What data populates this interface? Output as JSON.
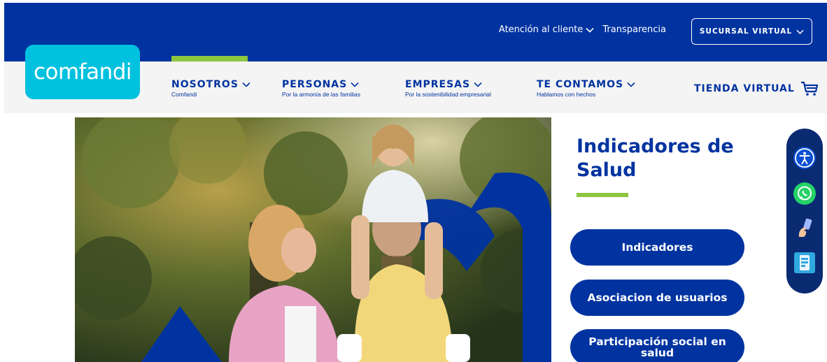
{
  "brand": {
    "logo_text": "comfandi",
    "primary": "#0033a0",
    "accent": "#8dc63f",
    "logo_bg": "#00c1de"
  },
  "topbar": {
    "links": [
      {
        "label": "Atención al cliente",
        "icon": "chevron-down-icon"
      },
      {
        "label": "Transparencia"
      }
    ],
    "sucursal_label": "SUCURSAL VIRTUAL"
  },
  "nav": {
    "items": [
      {
        "title": "NOSOTROS",
        "subtitle": "Comfandi",
        "active": true
      },
      {
        "title": "PERSONAS",
        "subtitle": "Por la armonía de las familias"
      },
      {
        "title": "EMPRESAS",
        "subtitle": "Por la sostenibilidad empresarial"
      },
      {
        "title": "TE CONTAMOS",
        "subtitle": "Hablamos con hechos"
      }
    ],
    "tienda_label": "TIENDA VIRTUAL",
    "tienda_icon": "cart-icon"
  },
  "panel": {
    "title": "Indicadores de Salud",
    "buttons": [
      {
        "label": "Indicadores"
      },
      {
        "label": "Asociacion de usuarios"
      },
      {
        "label": "Participación social en salud"
      }
    ]
  },
  "dock": {
    "items": [
      {
        "icon": "accessibility-icon"
      },
      {
        "icon": "whatsapp-icon"
      },
      {
        "icon": "hand-phone-icon"
      },
      {
        "icon": "mobile-app-icon"
      }
    ]
  }
}
